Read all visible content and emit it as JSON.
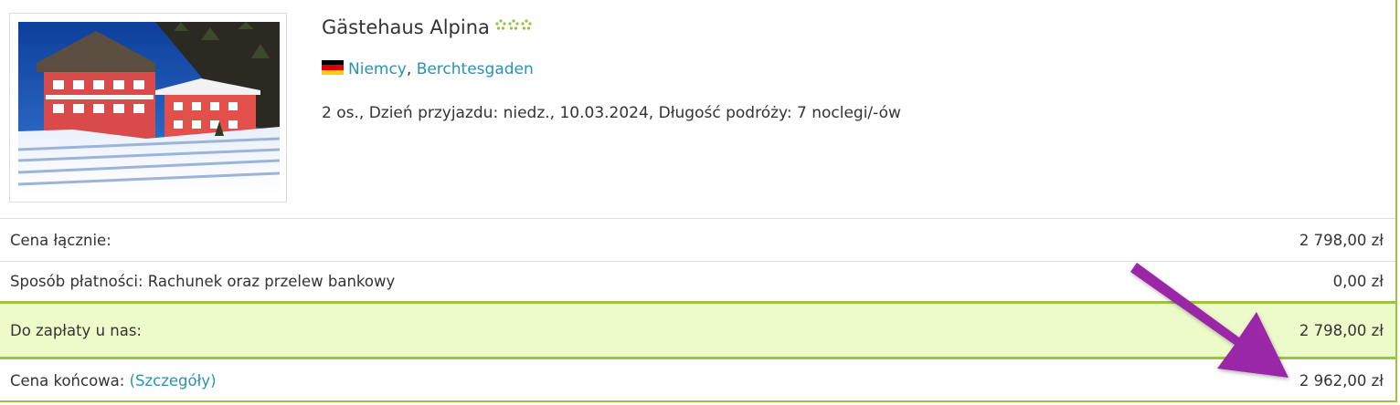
{
  "hotel": {
    "name": "Gästehaus Alpina",
    "stars": 3,
    "star_color": "#8cc63f",
    "country": "Niemcy",
    "country_separator": ",",
    "city": "Berchtesgaden",
    "flag": "germany-flag-icon",
    "travel_info": "2 os., Dzień przyjazdu: niedz., 10.03.2024, Długość podróży: 7 noclegi/-ów"
  },
  "summary": {
    "total_label": "Cena łącznie:",
    "total_value": "2 798,00 zł",
    "payment_label": "Sposób płatności: Rachunek oraz przelew bankowy",
    "payment_value": "0,00 zł",
    "due_label": "Do zapłaty u nas:",
    "due_value": "2 798,00 zł",
    "final_label": "Cena końcowa:",
    "final_details_link": "(Szczegóły)",
    "final_value": "2 962,00 zł"
  },
  "colors": {
    "accent_green": "#9bc53d",
    "due_background": "#edfbcb",
    "link": "#2a92b3",
    "annotation_arrow": "#9a27a8"
  }
}
